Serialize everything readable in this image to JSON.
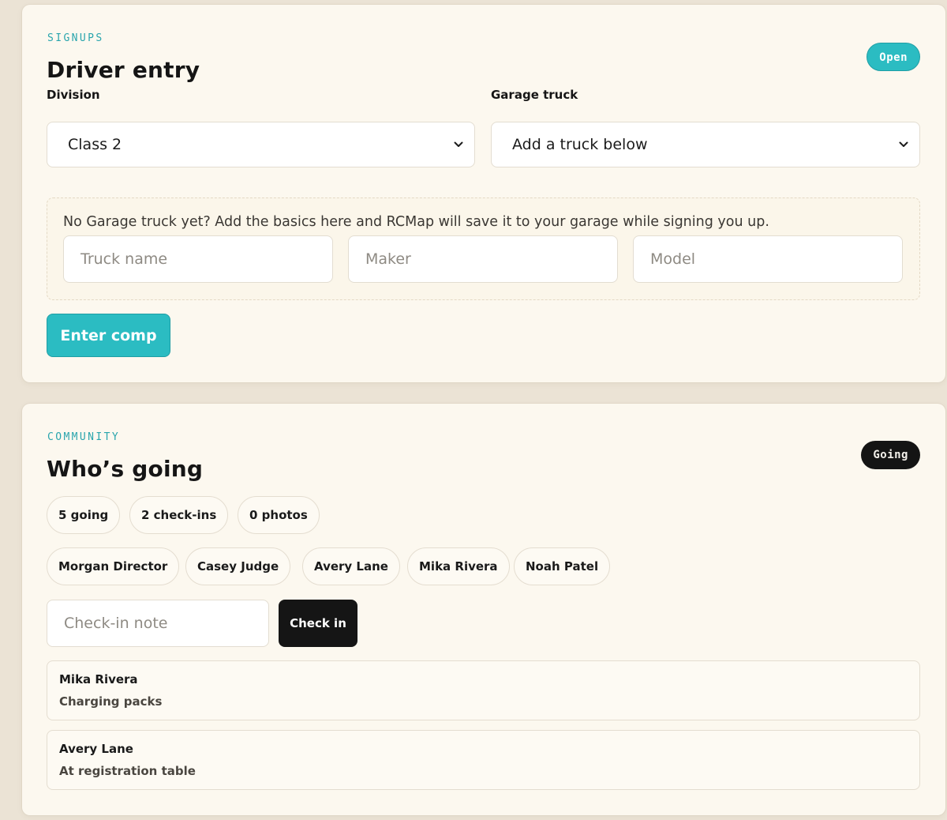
{
  "theme": {
    "background": "#ebe3d5",
    "card": "#fcf8ef",
    "accent": "#2bbcc2",
    "eyebrow": "#2aa5ad",
    "dark": "#151515"
  },
  "signups": {
    "eyebrow": "SIGNUPS",
    "title": "Driver entry",
    "status_badge": "Open",
    "division": {
      "label": "Division",
      "selected": "Class 2"
    },
    "garage_truck": {
      "label": "Garage truck",
      "selected": "Add a truck below"
    },
    "new_truck": {
      "helper": "No Garage truck yet? Add the basics here and RCMap will save it to your garage while signing you up.",
      "name_placeholder": "Truck name",
      "maker_placeholder": "Maker",
      "model_placeholder": "Model"
    },
    "submit_label": "Enter comp"
  },
  "community": {
    "eyebrow": "COMMUNITY",
    "title": "Who’s going",
    "status_badge": "Going",
    "stats": [
      {
        "label": "5 going"
      },
      {
        "label": "2 check-ins"
      },
      {
        "label": "0 photos"
      }
    ],
    "attendees": [
      {
        "name": "Morgan Director"
      },
      {
        "name": "Casey Judge"
      },
      {
        "name": "Avery Lane"
      },
      {
        "name": "Mika Rivera"
      },
      {
        "name": "Noah Patel"
      }
    ],
    "checkin": {
      "placeholder": "Check-in note",
      "button_label": "Check in"
    },
    "checkins": [
      {
        "name": "Mika Rivera",
        "note": "Charging packs"
      },
      {
        "name": "Avery Lane",
        "note": "At registration table"
      }
    ]
  }
}
